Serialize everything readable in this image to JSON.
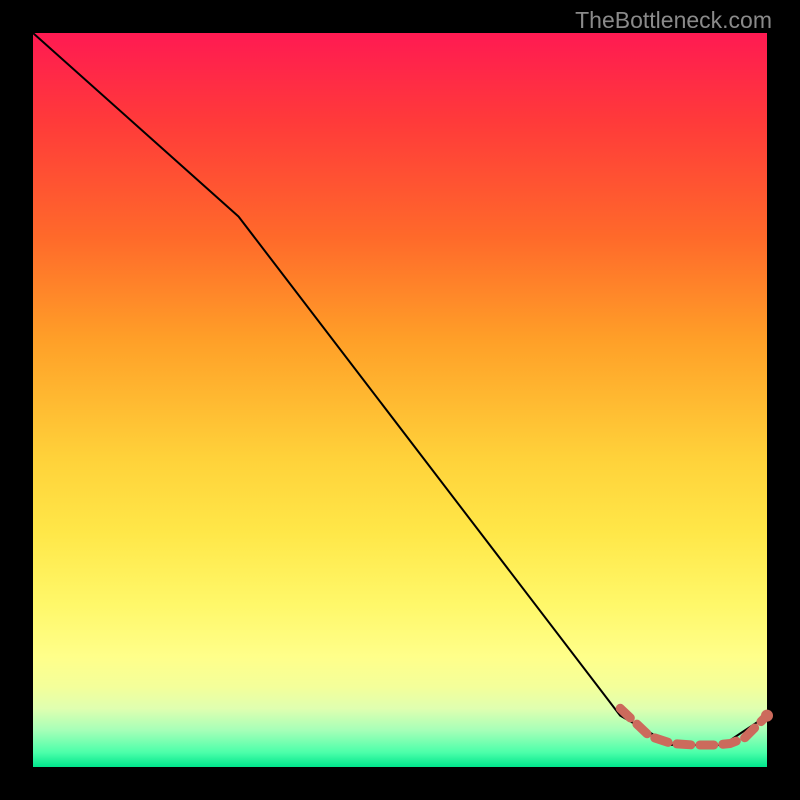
{
  "watermark": "TheBottleneck.com",
  "chart_data": {
    "type": "line",
    "title": "",
    "xlabel": "",
    "ylabel": "",
    "xlim": [
      0,
      100
    ],
    "ylim": [
      0,
      100
    ],
    "series": [
      {
        "name": "main-curve",
        "style": "solid-thin-black",
        "points": [
          {
            "x": 0,
            "y": 100
          },
          {
            "x": 28,
            "y": 75
          },
          {
            "x": 80,
            "y": 7
          },
          {
            "x": 87,
            "y": 3
          },
          {
            "x": 94,
            "y": 3
          },
          {
            "x": 100,
            "y": 7
          }
        ]
      },
      {
        "name": "highlight-segment",
        "style": "dashed-thick-indianred",
        "points": [
          {
            "x": 80,
            "y": 8
          },
          {
            "x": 84,
            "y": 4.2
          },
          {
            "x": 87,
            "y": 3.2
          },
          {
            "x": 90,
            "y": 3
          },
          {
            "x": 93,
            "y": 3
          },
          {
            "x": 95,
            "y": 3.2
          },
          {
            "x": 97,
            "y": 4
          },
          {
            "x": 100,
            "y": 7
          }
        ]
      }
    ],
    "colors": {
      "main_line": "#000000",
      "highlight": "#cc6a5c",
      "highlight_dot": "#cc6a5c"
    }
  }
}
